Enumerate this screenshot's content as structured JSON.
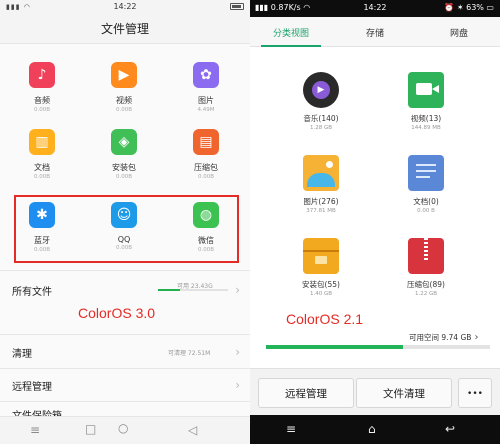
{
  "left": {
    "status_time": "14:22",
    "title": "文件管理",
    "categories": [
      {
        "name": "音频",
        "size": "0.00B",
        "color": "#f0405a",
        "glyph": "♪",
        "icon": "music-note-icon"
      },
      {
        "name": "视频",
        "size": "0.00B",
        "color": "#ff8a1d",
        "glyph": "▶",
        "icon": "play-icon"
      },
      {
        "name": "图片",
        "size": "4.49M",
        "color": "#8b6cf0",
        "glyph": "✿",
        "icon": "flower-icon"
      },
      {
        "name": "文档",
        "size": "0.00B",
        "color": "#ffb01d",
        "glyph": "▥",
        "icon": "bar-chart-icon"
      },
      {
        "name": "安装包",
        "size": "0.00B",
        "color": "#3fbf56",
        "glyph": "◈",
        "icon": "android-icon"
      },
      {
        "name": "压缩包",
        "size": "0.00B",
        "color": "#f0642e",
        "glyph": "▤",
        "icon": "archive-icon"
      },
      {
        "name": "蓝牙",
        "size": "0.00B",
        "color": "#1e8ff0",
        "glyph": "✱",
        "icon": "bluetooth-icon"
      },
      {
        "name": "QQ",
        "size": "0.00B",
        "color": "#1e9be8",
        "glyph": "☺",
        "icon": "qq-penguin-icon"
      },
      {
        "name": "微信",
        "size": "0.00B",
        "color": "#3cc250",
        "glyph": "◍",
        "icon": "wechat-icon"
      }
    ],
    "all_files": "所有文件",
    "all_files_avail": "可用 23.43G",
    "storage_used_fraction": 0.32,
    "clean": "清理",
    "clean_avail": "可清理 72.51M",
    "remote": "远程管理",
    "safe_box": "文件保险箱",
    "brand": "ColorOS 3.0"
  },
  "right": {
    "status_left": "0.87K/s",
    "status_time": "14:22",
    "status_right": "63%",
    "tabs": [
      "分类视图",
      "存储",
      "网盘"
    ],
    "categories": [
      {
        "name": "音乐(140)",
        "size": "1.28 GB",
        "icon": "music-disc-icon"
      },
      {
        "name": "视频(13)",
        "size": "144.89 MB",
        "icon": "video-camera-icon"
      },
      {
        "name": "图片(276)",
        "size": "377.81 MB",
        "icon": "picture-icon"
      },
      {
        "name": "文档(0)",
        "size": "0.00 B",
        "icon": "document-icon"
      },
      {
        "name": "安装包(55)",
        "size": "1.40 GB",
        "icon": "package-icon"
      },
      {
        "name": "压缩包(89)",
        "size": "1.22 GB",
        "icon": "zip-icon"
      }
    ],
    "brand": "ColorOS 2.1",
    "avail": "可用空间 9.74 GB",
    "storage_used_fraction": 0.61,
    "btn_remote": "远程管理",
    "btn_clean": "文件清理",
    "btn_more": "•••"
  }
}
